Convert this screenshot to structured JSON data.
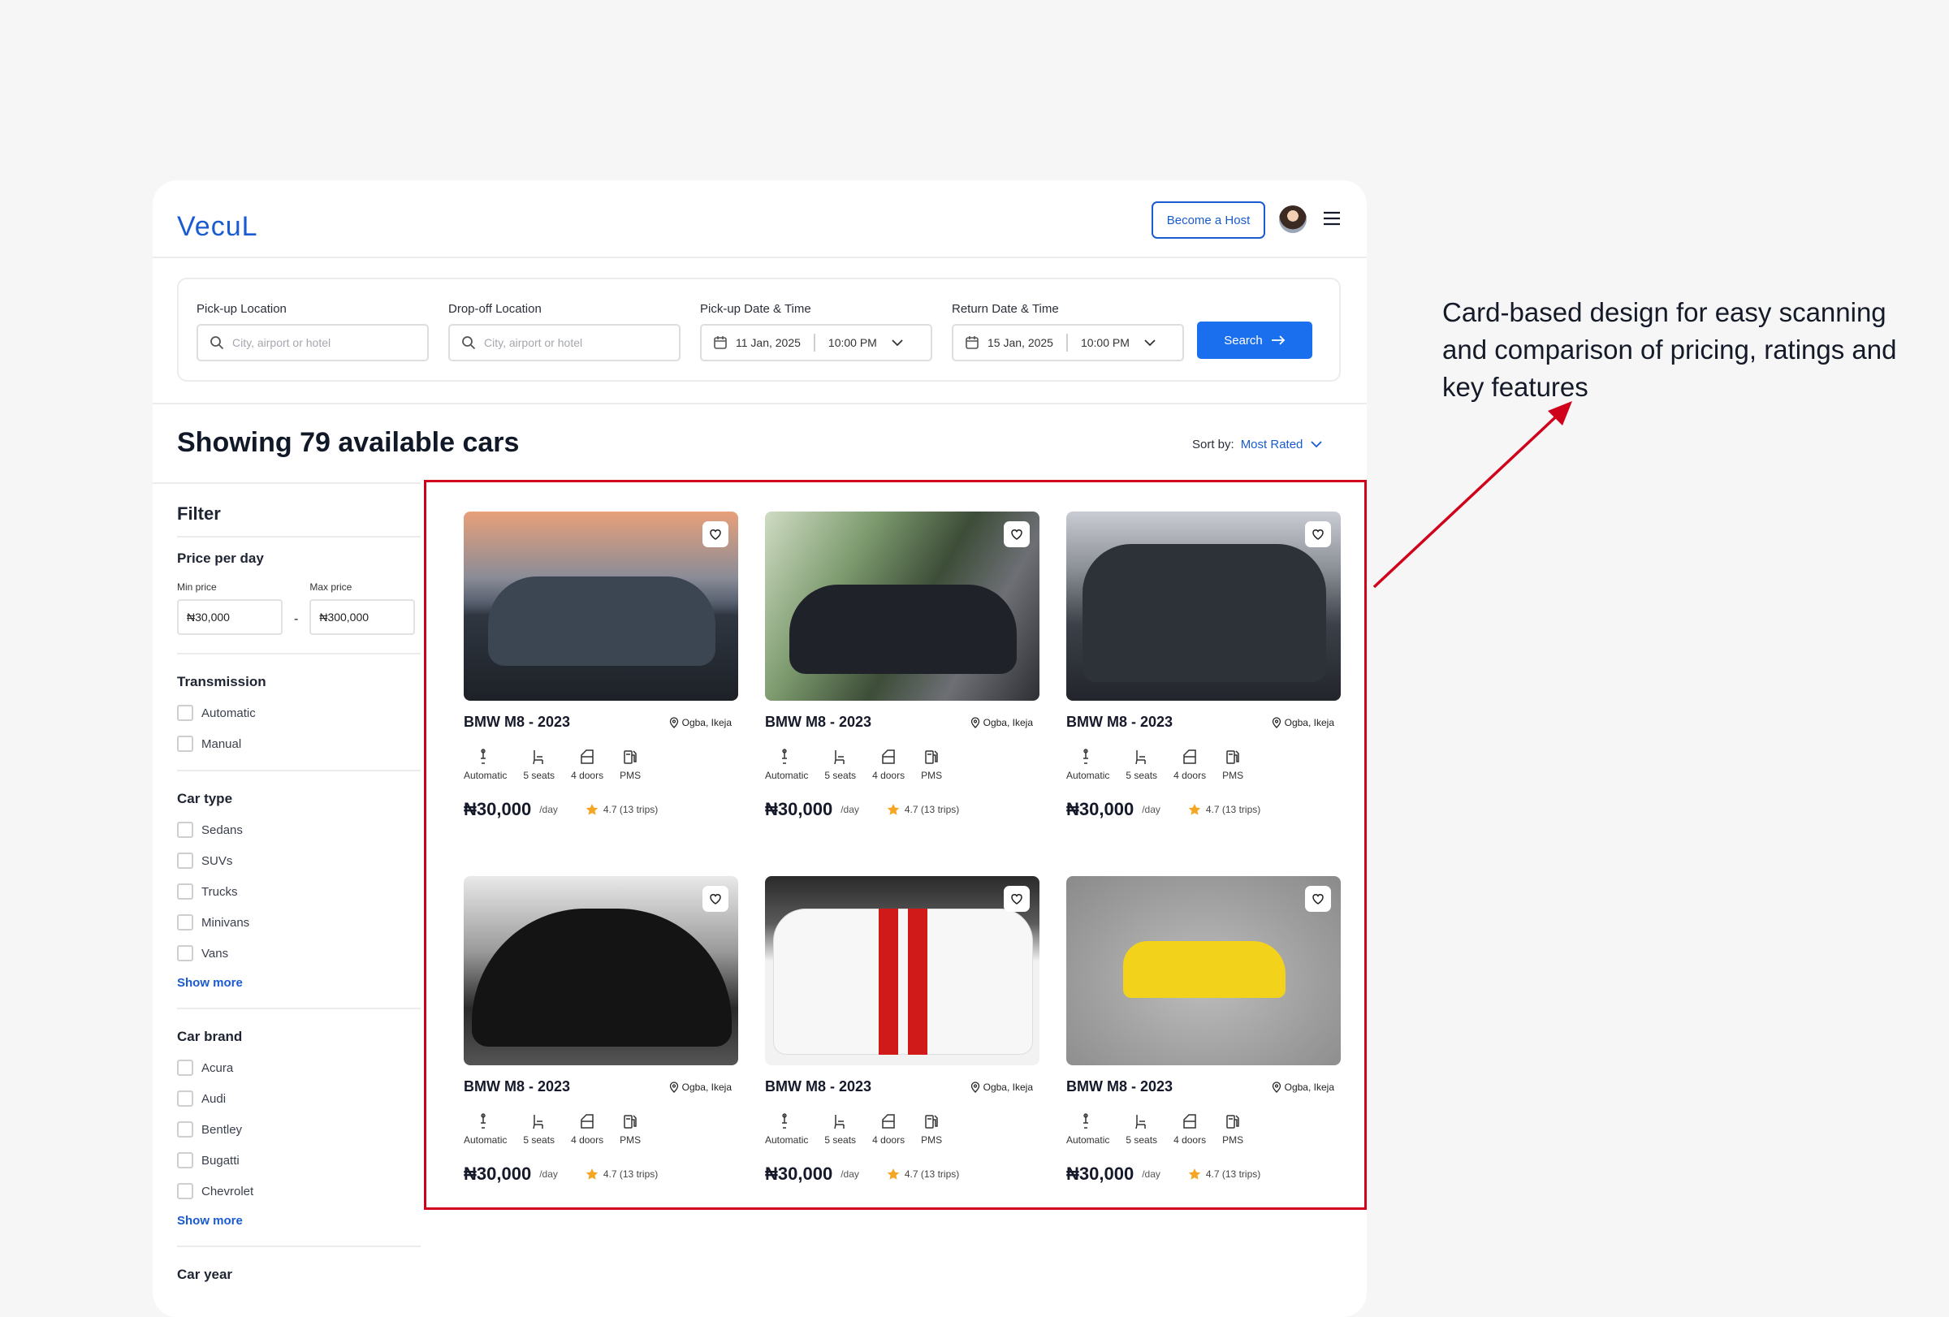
{
  "header": {
    "logo": "VecuL",
    "become_host": "Become a Host"
  },
  "search": {
    "pickup_location_label": "Pick-up Location",
    "dropoff_location_label": "Drop-off Location",
    "pickup_datetime_label": "Pick-up Date & Time",
    "return_datetime_label": "Return Date & Time",
    "location_placeholder": "City, airport or hotel",
    "pickup_date": "11 Jan, 2025",
    "pickup_time": "10:00 PM",
    "return_date": "15 Jan, 2025",
    "return_time": "10:00 PM",
    "search_button": "Search"
  },
  "results": {
    "title": "Showing 79 available cars",
    "sort_label": "Sort by:",
    "sort_value": "Most Rated"
  },
  "filter": {
    "title": "Filter",
    "price": {
      "title": "Price per day",
      "min_label": "Min price",
      "max_label": "Max price",
      "min_value": "₦30,000",
      "max_value": "₦300,000",
      "dash": "-"
    },
    "transmission": {
      "title": "Transmission",
      "options": [
        "Automatic",
        "Manual"
      ]
    },
    "car_type": {
      "title": "Car type",
      "options": [
        "Sedans",
        "SUVs",
        "Trucks",
        "Minivans",
        "Vans"
      ],
      "show_more": "Show more"
    },
    "car_brand": {
      "title": "Car brand",
      "options": [
        "Acura",
        "Audi",
        "Bentley",
        "Bugatti",
        "Chevrolet"
      ],
      "show_more": "Show more"
    },
    "car_year": {
      "title": "Car year"
    }
  },
  "cards": [
    {
      "name": "BMW M8 - 2023",
      "location": "Ogba, Ikeja",
      "transmission": "Automatic",
      "seats": "5 seats",
      "doors": "4 doors",
      "fuel": "PMS",
      "price": "₦30,000",
      "per": "/day",
      "rating": "4.7 (13 trips)"
    },
    {
      "name": "BMW M8 - 2023",
      "location": "Ogba, Ikeja",
      "transmission": "Automatic",
      "seats": "5 seats",
      "doors": "4 doors",
      "fuel": "PMS",
      "price": "₦30,000",
      "per": "/day",
      "rating": "4.7 (13 trips)"
    },
    {
      "name": "BMW M8 - 2023",
      "location": "Ogba, Ikeja",
      "transmission": "Automatic",
      "seats": "5 seats",
      "doors": "4 doors",
      "fuel": "PMS",
      "price": "₦30,000",
      "per": "/day",
      "rating": "4.7 (13 trips)"
    },
    {
      "name": "BMW M8 - 2023",
      "location": "Ogba, Ikeja",
      "transmission": "Automatic",
      "seats": "5 seats",
      "doors": "4 doors",
      "fuel": "PMS",
      "price": "₦30,000",
      "per": "/day",
      "rating": "4.7 (13 trips)"
    },
    {
      "name": "BMW M8 - 2023",
      "location": "Ogba, Ikeja",
      "transmission": "Automatic",
      "seats": "5 seats",
      "doors": "4 doors",
      "fuel": "PMS",
      "price": "₦30,000",
      "per": "/day",
      "rating": "4.7 (13 trips)"
    },
    {
      "name": "BMW M8 - 2023",
      "location": "Ogba, Ikeja",
      "transmission": "Automatic",
      "seats": "5 seats",
      "doors": "4 doors",
      "fuel": "PMS",
      "price": "₦30,000",
      "per": "/day",
      "rating": "4.7 (13 trips)"
    }
  ],
  "annotation": {
    "text": "Card-based design for easy scanning and comparison of pricing, ratings and key features"
  },
  "colors": {
    "accent": "#1a6fef",
    "brand": "#1a5bd0",
    "highlight": "#d0021b",
    "star": "#f5a623"
  },
  "icons": [
    "search-icon",
    "calendar-icon",
    "chevron-down-icon",
    "arrow-right-icon",
    "heart-icon",
    "location-pin-icon",
    "gear-shift-icon",
    "seat-icon",
    "door-icon",
    "fuel-pump-icon",
    "star-icon",
    "hamburger-menu-icon"
  ]
}
